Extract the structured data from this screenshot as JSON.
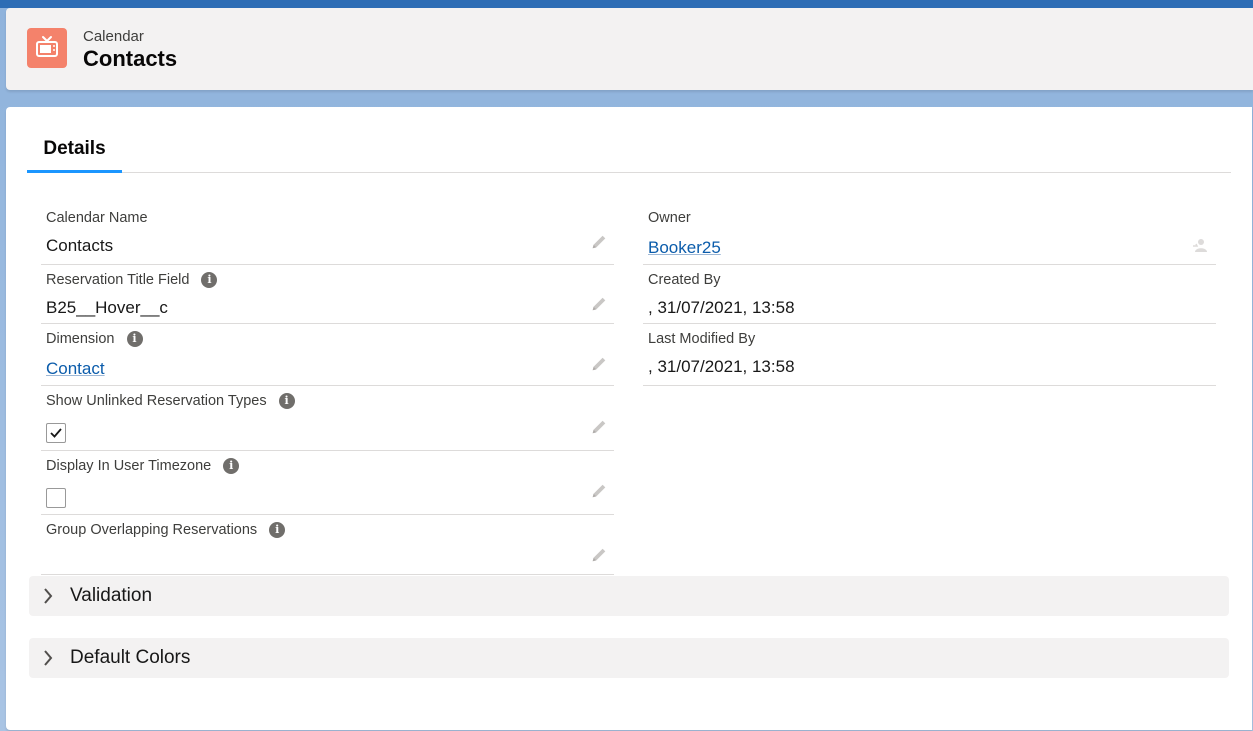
{
  "header": {
    "object_label": "Calendar",
    "record_title": "Contacts",
    "icon": "tv-icon",
    "icon_color": "#f4826b"
  },
  "tabs": [
    {
      "label": "Details",
      "active": true
    }
  ],
  "left_fields": {
    "calendar_name": {
      "label": "Calendar Name",
      "value": "Contacts"
    },
    "reservation_title_field": {
      "label": "Reservation Title Field",
      "value": "B25__Hover__c"
    },
    "dimension": {
      "label": "Dimension",
      "value": "Contact"
    },
    "show_unlinked_reservation_types": {
      "label": "Show Unlinked Reservation Types",
      "checked": true
    },
    "display_in_user_timezone": {
      "label": "Display In User Timezone",
      "checked": false
    },
    "group_overlapping_reservations": {
      "label": "Group Overlapping Reservations",
      "value": ""
    }
  },
  "right_fields": {
    "owner": {
      "label": "Owner",
      "value": "Booker25"
    },
    "created_by": {
      "label": "Created By",
      "value": ", 31/07/2021, 13:58"
    },
    "last_modified_by": {
      "label": "Last Modified By",
      "value": ", 31/07/2021, 13:58"
    }
  },
  "sections": [
    {
      "label": "Validation",
      "expanded": false
    },
    {
      "label": "Default Colors",
      "expanded": false
    }
  ],
  "colors": {
    "link": "#0b5cab",
    "tab_indicator": "#1b96ff"
  }
}
